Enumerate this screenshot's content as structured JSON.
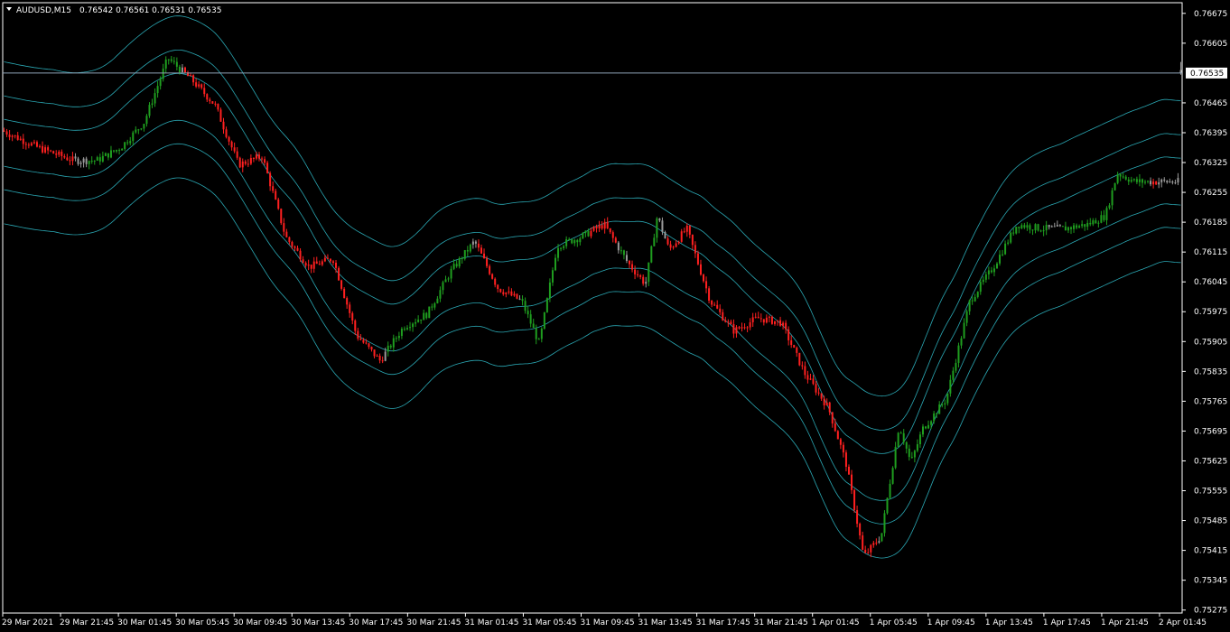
{
  "header": {
    "symbol": "AUDUSD,M15",
    "ohlc": "0.76542 0.76561 0.76531 0.76535"
  },
  "current_price_label": "0.76535",
  "colors": {
    "background": "#000000",
    "bull": "#1f9e1f",
    "bear": "#ff2020",
    "neutral": "#9a9a9a",
    "bands": "#2aa7b3",
    "price_line": "#8fa3b8",
    "axis": "#ffffff"
  },
  "chart_data": {
    "type": "candlestick",
    "symbol": "AUDUSD",
    "timeframe": "M15",
    "ylim": [
      0.75268,
      0.767
    ],
    "y_ticks": [
      "0.76675",
      "0.76605",
      "0.76535",
      "0.76465",
      "0.76395",
      "0.76325",
      "0.76255",
      "0.76185",
      "0.76115",
      "0.76045",
      "0.75975",
      "0.75905",
      "0.75835",
      "0.75765",
      "0.75695",
      "0.75625",
      "0.75555",
      "0.75485",
      "0.75415",
      "0.75345",
      "0.75275"
    ],
    "x_ticks": [
      "29 Mar 2021",
      "29 Mar 21:45",
      "30 Mar 01:45",
      "30 Mar 05:45",
      "30 Mar 09:45",
      "30 Mar 13:45",
      "30 Mar 17:45",
      "30 Mar 21:45",
      "31 Mar 01:45",
      "31 Mar 05:45",
      "31 Mar 09:45",
      "31 Mar 13:45",
      "31 Mar 17:45",
      "31 Mar 21:45",
      "1 Apr 01:45",
      "1 Apr 05:45",
      "1 Apr 09:45",
      "1 Apr 13:45",
      "1 Apr 17:45",
      "1 Apr 21:45",
      "2 Apr 01:45"
    ],
    "current_price": 0.76535,
    "last_candle": {
      "open": 0.76542,
      "high": 0.76561,
      "low": 0.76531,
      "close": 0.76535
    },
    "close_path": [
      [
        0,
        0.764
      ],
      [
        0.03,
        0.7636
      ],
      [
        0.06,
        0.7633
      ],
      [
        0.08,
        0.7633
      ],
      [
        0.1,
        0.7636
      ],
      [
        0.12,
        0.7642
      ],
      [
        0.14,
        0.7657
      ],
      [
        0.16,
        0.7652
      ],
      [
        0.18,
        0.7646
      ],
      [
        0.2,
        0.7632
      ],
      [
        0.22,
        0.7634
      ],
      [
        0.24,
        0.7615
      ],
      [
        0.26,
        0.7608
      ],
      [
        0.28,
        0.761
      ],
      [
        0.3,
        0.7592
      ],
      [
        0.32,
        0.7586
      ],
      [
        0.34,
        0.7594
      ],
      [
        0.36,
        0.7597
      ],
      [
        0.38,
        0.7607
      ],
      [
        0.4,
        0.7614
      ],
      [
        0.42,
        0.7603
      ],
      [
        0.44,
        0.76
      ],
      [
        0.455,
        0.759
      ],
      [
        0.47,
        0.7613
      ],
      [
        0.49,
        0.7615
      ],
      [
        0.51,
        0.7618
      ],
      [
        0.53,
        0.7609
      ],
      [
        0.545,
        0.7604
      ],
      [
        0.555,
        0.762
      ],
      [
        0.565,
        0.7612
      ],
      [
        0.58,
        0.7617
      ],
      [
        0.6,
        0.76
      ],
      [
        0.62,
        0.7593
      ],
      [
        0.64,
        0.7596
      ],
      [
        0.66,
        0.7595
      ],
      [
        0.68,
        0.7583
      ],
      [
        0.7,
        0.7575
      ],
      [
        0.715,
        0.7562
      ],
      [
        0.73,
        0.754
      ],
      [
        0.745,
        0.7545
      ],
      [
        0.76,
        0.7571
      ],
      [
        0.77,
        0.7562
      ],
      [
        0.78,
        0.757
      ],
      [
        0.8,
        0.7577
      ],
      [
        0.82,
        0.76
      ],
      [
        0.84,
        0.7608
      ],
      [
        0.86,
        0.7618
      ],
      [
        0.88,
        0.7617
      ],
      [
        0.9,
        0.7617
      ],
      [
        0.92,
        0.7618
      ],
      [
        0.935,
        0.762
      ],
      [
        0.945,
        0.763
      ],
      [
        0.96,
        0.7628
      ]
    ],
    "band_offsets": [
      -0.0019,
      -0.0011,
      -0.00055,
      0.00055,
      0.0011,
      0.0019
    ],
    "grid": false
  }
}
